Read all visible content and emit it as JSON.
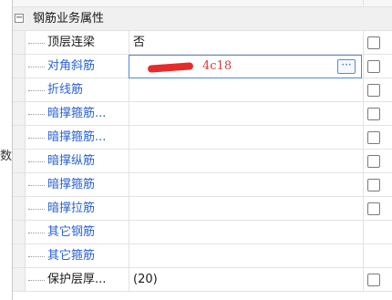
{
  "left_fragment": "数",
  "group": {
    "title": "钢筋业务属性",
    "toggle": "−"
  },
  "rows": [
    {
      "name": "顶层连梁",
      "value": "否",
      "color": "#1a1a1a",
      "checkbox": true
    },
    {
      "name": "对角斜筋",
      "value": "4c18",
      "color": "#2b63d6",
      "checkbox": true,
      "selected": true,
      "button": "···"
    },
    {
      "name": "折线筋",
      "value": "",
      "color": "#2b63d6",
      "checkbox": true
    },
    {
      "name": "暗撑箍筋...",
      "value": "",
      "color": "#2b63d6",
      "checkbox": true
    },
    {
      "name": "暗撑箍筋...",
      "value": "",
      "color": "#2b63d6",
      "checkbox": true
    },
    {
      "name": "暗撑纵筋",
      "value": "",
      "color": "#2b63d6",
      "checkbox": true
    },
    {
      "name": "暗撑箍筋",
      "value": "",
      "color": "#2b63d6",
      "checkbox": true
    },
    {
      "name": "暗撑拉筋",
      "value": "",
      "color": "#2b63d6",
      "checkbox": true
    },
    {
      "name": "其它钢筋",
      "value": "",
      "color": "#2b63d6",
      "checkbox": false
    },
    {
      "name": "其它箍筋",
      "value": "",
      "color": "#2b63d6",
      "checkbox": false
    },
    {
      "name": "保护层厚...",
      "value": "(20)",
      "color": "#1a1a1a",
      "checkbox": true
    }
  ]
}
